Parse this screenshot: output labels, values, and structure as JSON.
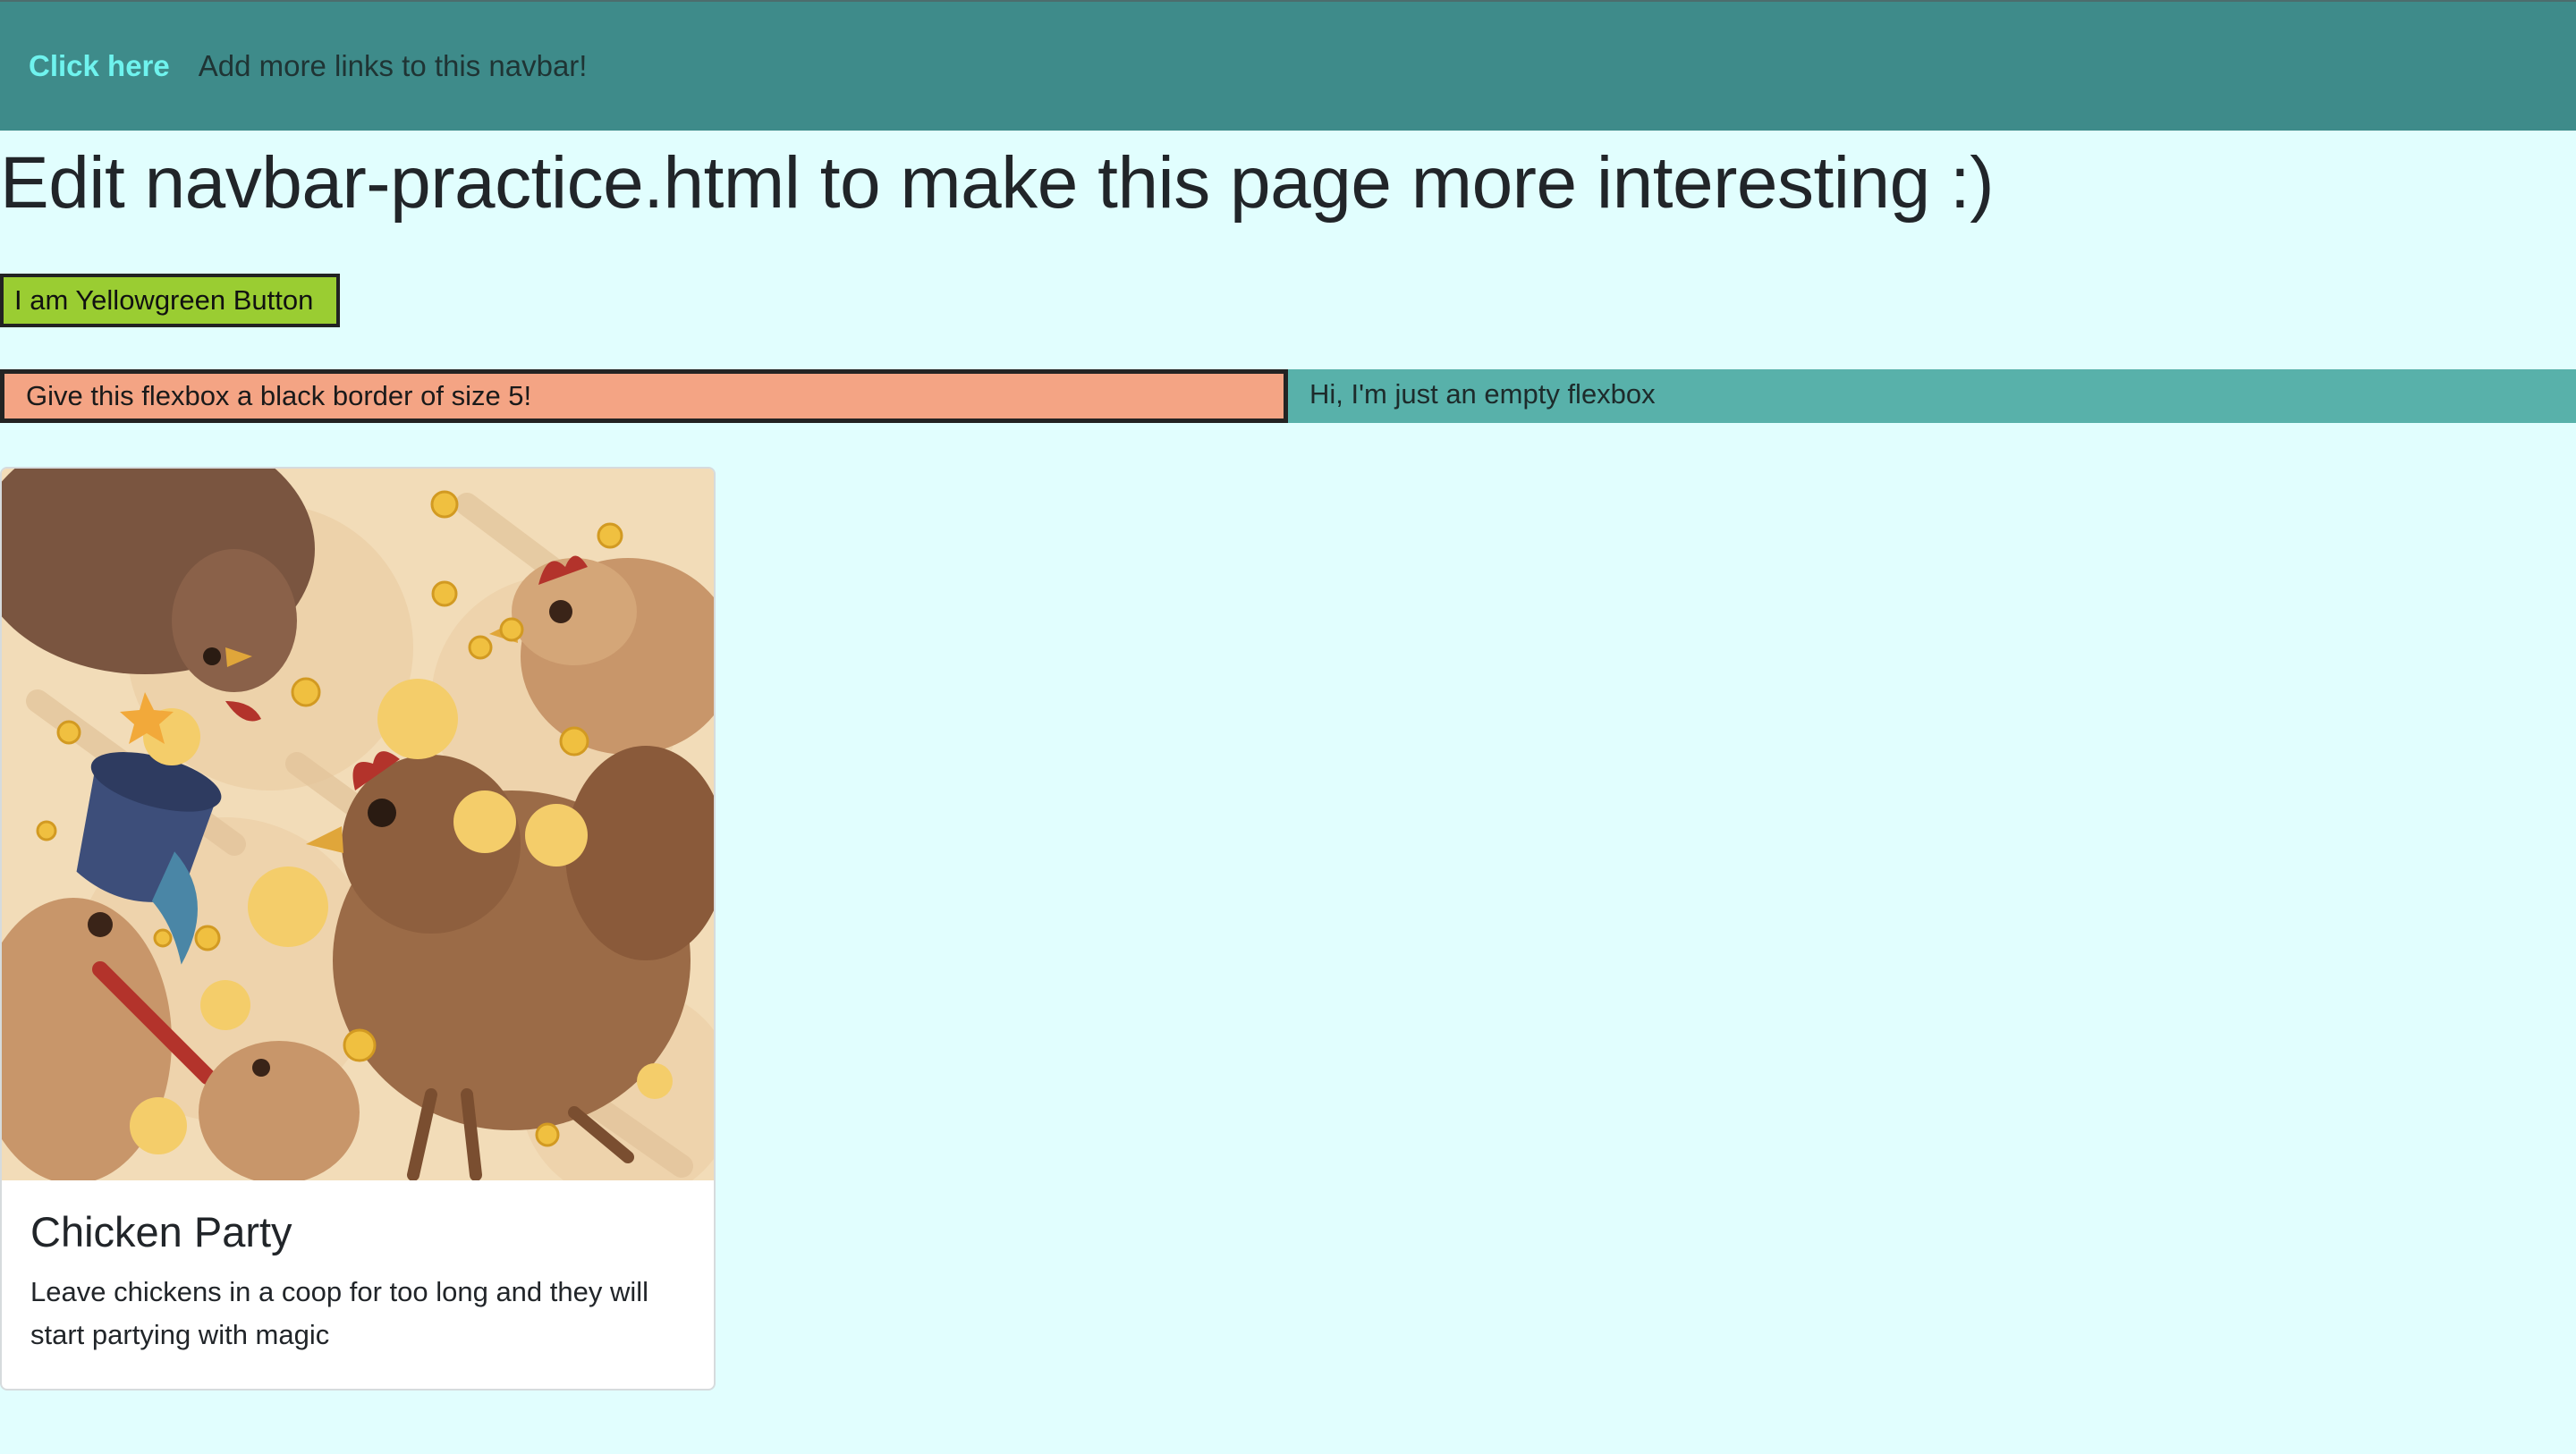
{
  "navbar": {
    "link_label": "Click here",
    "text": "Add more links to this navbar!"
  },
  "page": {
    "title": "Edit navbar-practice.html to make this page more interesting :)"
  },
  "button": {
    "label": "I am Yellowgreen Button"
  },
  "flexboxes": {
    "left_text": "Give this flexbox a black border of size 5!",
    "right_text": "Hi, I'm just an empty flexbox"
  },
  "card": {
    "title": "Chicken Party",
    "text": "Leave chickens in a coop for too long and they will start partying with magic"
  },
  "colors": {
    "page_background": "#e1fefe",
    "navbar": "#3e8b8a",
    "nav_link": "#6ff3ee",
    "button": "#9acd32",
    "flex_left": "#f4a484",
    "flex_right": "#58b1aa"
  }
}
